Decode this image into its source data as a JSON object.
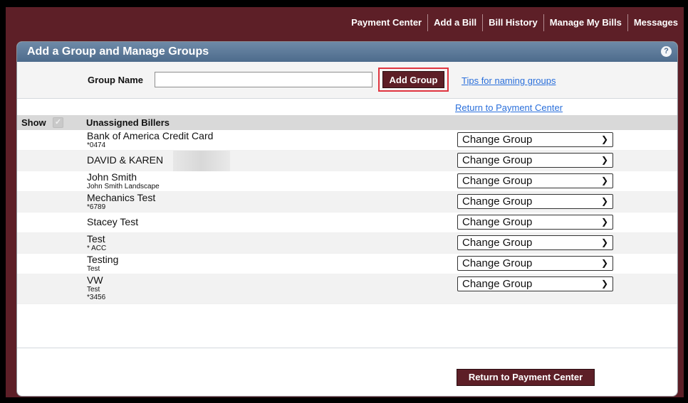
{
  "nav": {
    "items": [
      "Payment Center",
      "Add a Bill",
      "Bill History",
      "Manage My Bills",
      "Messages"
    ]
  },
  "panel": {
    "title": "Add a Group and Manage Groups",
    "help": "?"
  },
  "group_form": {
    "label": "Group Name",
    "value": "",
    "add_button": "Add Group",
    "tips_link": "Tips for naming groups"
  },
  "return_link": "Return to Payment Center",
  "table": {
    "show_label": "Show",
    "header": "Unassigned Billers",
    "select_value": "Change Group",
    "billers": [
      {
        "name": "Bank of America Credit Card",
        "sub": [
          "*0474"
        ]
      },
      {
        "name": "DAVID & KAREN",
        "sub": []
      },
      {
        "name": "John Smith",
        "sub": [
          "John Smith Landscape"
        ]
      },
      {
        "name": "Mechanics Test",
        "sub": [
          "*6789"
        ]
      },
      {
        "name": "Stacey Test",
        "sub": []
      },
      {
        "name": "Test",
        "sub": [
          "* ACC"
        ]
      },
      {
        "name": "Testing",
        "sub": [
          "Test"
        ]
      },
      {
        "name": "VW",
        "sub": [
          "Test",
          "*3456"
        ]
      }
    ]
  },
  "return_button": "Return to Payment Center",
  "colors": {
    "brand_maroon": "#5d1f27",
    "header_blue": "#4d6b8c",
    "link_blue": "#2a6fdb",
    "highlight_red": "#e0343f"
  }
}
